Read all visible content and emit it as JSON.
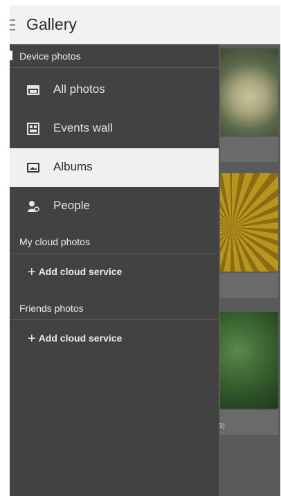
{
  "app": {
    "title": "Gallery"
  },
  "drawer": {
    "device_section": {
      "header": "Device photos",
      "items": [
        {
          "label": "All photos",
          "icon": "photo-icon"
        },
        {
          "label": "Events wall",
          "icon": "events-wall-icon"
        },
        {
          "label": "Albums",
          "icon": "album-icon",
          "selected": true
        },
        {
          "label": "People",
          "icon": "person-icon"
        }
      ]
    },
    "cloud_section": {
      "header": "My cloud photos",
      "add_label": "Add cloud service"
    },
    "friends_section": {
      "header": "Friends photos",
      "add_label": "Add cloud service"
    }
  },
  "background": {
    "caption_fragment": "3)"
  },
  "colors": {
    "drawer_bg": "#424242",
    "selected_bg": "#f0f0f0",
    "titlebar_bg": "#f2f2f2"
  }
}
